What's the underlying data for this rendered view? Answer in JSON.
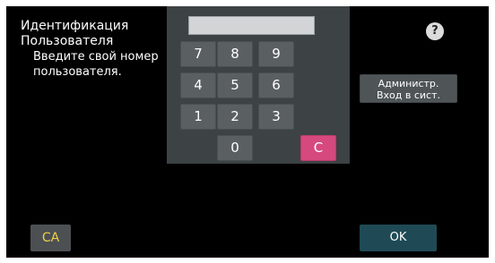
{
  "header": {
    "title_line1": "Идентификация",
    "title_line2": "Пользователя",
    "instruction_line1": "Введите свой номер",
    "instruction_line2": "пользователя."
  },
  "input": {
    "user_number_value": ""
  },
  "keypad": {
    "keys": [
      "7",
      "8",
      "9",
      "4",
      "5",
      "6",
      "1",
      "2",
      "3",
      "0"
    ],
    "clear_label": "C"
  },
  "help": {
    "icon": "question-icon",
    "label": "?"
  },
  "admin_login": {
    "line1": "Администр.",
    "line2": "Вход в сист."
  },
  "footer": {
    "ca_label": "CA",
    "ok_label": "OK"
  },
  "colors": {
    "background": "#000000",
    "keypad_panel": "#3d4244",
    "key": "#5a5f62",
    "clear_key": "#d5497e",
    "ca_text": "#f0d046",
    "ok_button": "#1f4a55"
  }
}
